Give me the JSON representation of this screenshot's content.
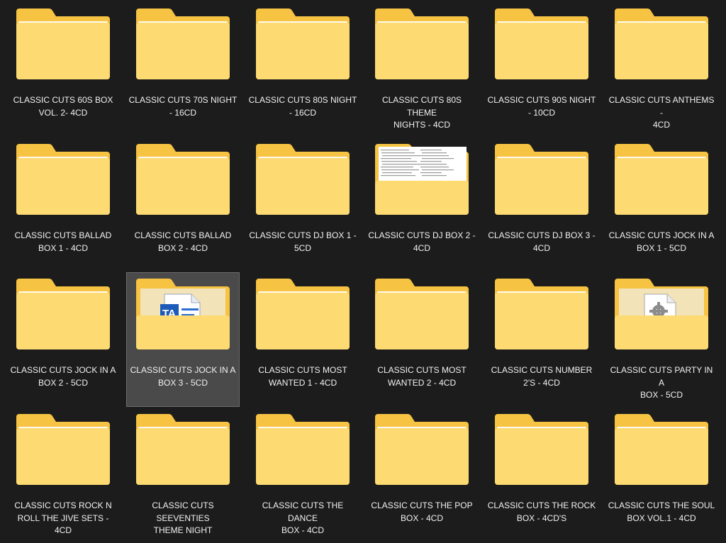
{
  "window": {
    "view": "large-icons"
  },
  "colors": {
    "background": "#1c1c1c",
    "folder_back": "#f6c343",
    "folder_front": "#fdda72",
    "paper": "#ffffff",
    "selection": "#4a4a4a"
  },
  "folders": [
    {
      "name": "CLASSIC CUTS 60S BOX\nVOL. 2-  4CD",
      "preview": "none",
      "selected": false
    },
    {
      "name": "CLASSIC CUTS 70S NIGHT\n- 16CD",
      "preview": "none",
      "selected": false
    },
    {
      "name": "CLASSIC CUTS 80S NIGHT\n- 16CD",
      "preview": "none",
      "selected": false
    },
    {
      "name": "CLASSIC CUTS 80S THEME\nNIGHTS - 4CD",
      "preview": "none",
      "selected": false
    },
    {
      "name": "CLASSIC CUTS 90S NIGHT\n- 10CD",
      "preview": "none",
      "selected": false
    },
    {
      "name": "CLASSIC CUTS ANTHEMS -\n4CD",
      "preview": "none",
      "selected": false
    },
    {
      "name": "CLASSIC CUTS BALLAD\nBOX 1 - 4CD",
      "preview": "none",
      "selected": false
    },
    {
      "name": "CLASSIC CUTS BALLAD\nBOX 2 - 4CD",
      "preview": "none",
      "selected": false
    },
    {
      "name": "CLASSIC CUTS DJ BOX 1 -\n5CD",
      "preview": "none",
      "selected": false
    },
    {
      "name": "CLASSIC CUTS DJ BOX 2 -\n4CD",
      "preview": "document",
      "selected": false
    },
    {
      "name": "CLASSIC CUTS DJ BOX 3 -\n4CD",
      "preview": "none",
      "selected": false
    },
    {
      "name": "CLASSIC CUTS JOCK IN A\nBOX 1 - 5CD",
      "preview": "none",
      "selected": false
    },
    {
      "name": "CLASSIC CUTS JOCK IN A\nBOX 2 - 5CD",
      "preview": "none",
      "selected": false
    },
    {
      "name": "CLASSIC CUTS JOCK IN A\nBOX 3 - 5CD",
      "preview": "word-file",
      "selected": true
    },
    {
      "name": "CLASSIC CUTS MOST\nWANTED 1 - 4CD",
      "preview": "none",
      "selected": false
    },
    {
      "name": "CLASSIC CUTS MOST\nWANTED 2 - 4CD",
      "preview": "none",
      "selected": false
    },
    {
      "name": "CLASSIC CUTS NUMBER\n2'S - 4CD",
      "preview": "none",
      "selected": false
    },
    {
      "name": "CLASSIC CUTS PARTY IN A\nBOX - 5CD",
      "preview": "settings-file",
      "selected": false
    },
    {
      "name": "CLASSIC CUTS ROCK N\nROLL THE JIVE SETS - 4CD",
      "preview": "none",
      "selected": false
    },
    {
      "name": "CLASSIC CUTS SEEVENTIES\nTHEME NIGHT",
      "preview": "none",
      "selected": false
    },
    {
      "name": "CLASSIC CUTS THE DANCE\nBOX - 4CD",
      "preview": "none",
      "selected": false
    },
    {
      "name": "CLASSIC CUTS THE POP\nBOX - 4CD",
      "preview": "none",
      "selected": false
    },
    {
      "name": "CLASSIC CUTS THE ROCK\nBOX - 4CD'S",
      "preview": "none",
      "selected": false
    },
    {
      "name": "CLASSIC CUTS THE SOUL\nBOX VOL.1 - 4CD",
      "preview": "none",
      "selected": false
    }
  ]
}
